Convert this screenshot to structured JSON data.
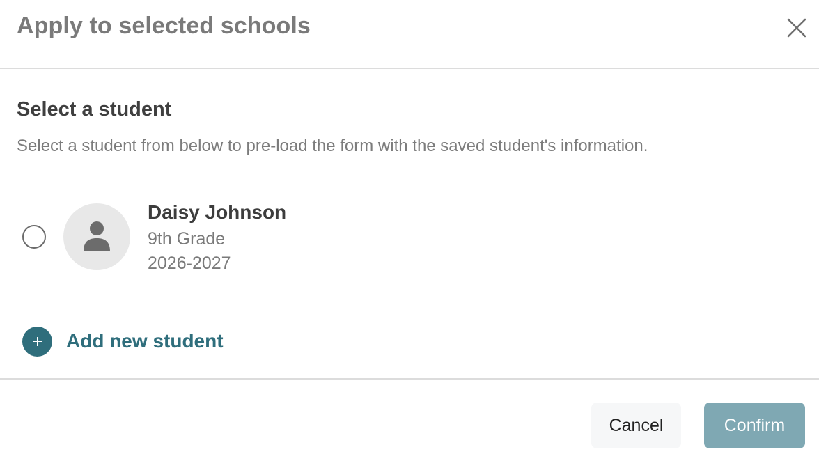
{
  "modal": {
    "title": "Apply to selected schools",
    "close_icon": "close-icon"
  },
  "section": {
    "title": "Select a student",
    "description": "Select a student from below to pre-load the form with the saved student's information."
  },
  "students": [
    {
      "name": "Daisy Johnson",
      "grade": "9th Grade",
      "year": "2026-2027",
      "selected": false,
      "avatar_icon": "person-icon"
    }
  ],
  "add_student": {
    "label": "Add new student",
    "icon": "plus-icon"
  },
  "footer": {
    "cancel_label": "Cancel",
    "confirm_label": "Confirm"
  },
  "colors": {
    "accent": "#2f6e7c",
    "confirm_button": "#7fa8b3",
    "cancel_button": "#f6f7f8",
    "title_text": "#7a7a7a",
    "avatar_bg": "#e8e8e8"
  }
}
